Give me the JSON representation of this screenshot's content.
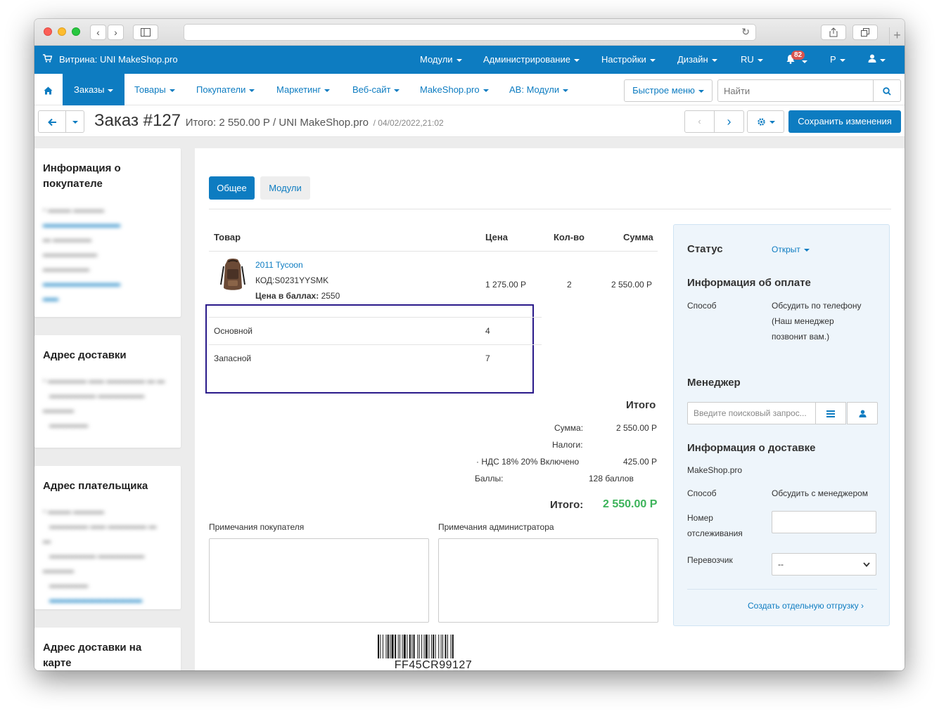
{
  "topbar": {
    "store_label": "Витрина: UNI MakeShop.pro",
    "menus": [
      "Модули",
      "Администрирование",
      "Настройки",
      "Дизайн",
      "RU"
    ],
    "notification_count": "82",
    "currency": "Р"
  },
  "nav": {
    "items": [
      "Заказы",
      "Товары",
      "Покупатели",
      "Маркетинг",
      "Веб-сайт",
      "MakeShop.pro",
      "AB: Модули"
    ],
    "quick_menu": "Быстрое меню",
    "search_placeholder": "Найти"
  },
  "header": {
    "title": "Заказ #127",
    "subtitle": "Итого: 2 550.00 Р / UNI MakeShop.pro",
    "date": "/ 04/02/2022,21:02",
    "save_label": "Сохранить изменения"
  },
  "sidebar": {
    "buyer_info_title": "Информация о покупателе",
    "delivery_address_title": "Адрес доставки",
    "payer_address_title": "Адрес плательщика",
    "map_title": "Адрес доставки на карте"
  },
  "tabs": [
    "Общее",
    "Модули"
  ],
  "table": {
    "headers": [
      "Товар",
      "Цена",
      "Кол-во",
      "Сумма"
    ],
    "product": {
      "name": "2011 Tycoon",
      "code": "КОД:S0231YYSMK",
      "points_label": "Цена в баллах:",
      "points_value": "2550",
      "price": "1 275.00 Р",
      "qty": "2",
      "sum": "2 550.00 Р"
    },
    "warehouses": [
      {
        "name": "Основной",
        "value": "4"
      },
      {
        "name": "Запасной",
        "value": "7"
      }
    ]
  },
  "totals": {
    "heading": "Итого",
    "sum_label": "Сумма:",
    "sum_value": "2 550.00 Р",
    "tax_label": "Налоги:",
    "vat_label": "· НДС 18% 20% Включено",
    "vat_value": "425.00 Р",
    "points_label": "Баллы:",
    "points_value": "128 баллов",
    "total_label": "Итого:",
    "total_value": "2 550.00 Р"
  },
  "notes": {
    "buyer_label": "Примечания покупателя",
    "admin_label": "Примечания администратора"
  },
  "barcode": "FF45CR99127",
  "panel": {
    "status_label": "Статус",
    "status_value": "Открыт",
    "payment_title": "Информация об оплате",
    "payment_method_label": "Способ",
    "payment_method_value": "Обсудить по телефону (Наш менеджер позвонит вам.)",
    "manager_title": "Менеджер",
    "manager_placeholder": "Введите поисковый запрос...",
    "delivery_title": "Информация о доставке",
    "delivery_company": "MakeShop.pro",
    "delivery_method_label": "Способ",
    "delivery_method_value": "Обсудить с менеджером",
    "tracking_label": "Номер отслеживания",
    "carrier_label": "Перевозчик",
    "carrier_value": "--",
    "shipment_link": "Создать отдельную отгрузку ›"
  },
  "colors": {
    "primary": "#0d7cc1",
    "total_green": "#3cb35a",
    "highlight_box": "#2a1a8a"
  }
}
